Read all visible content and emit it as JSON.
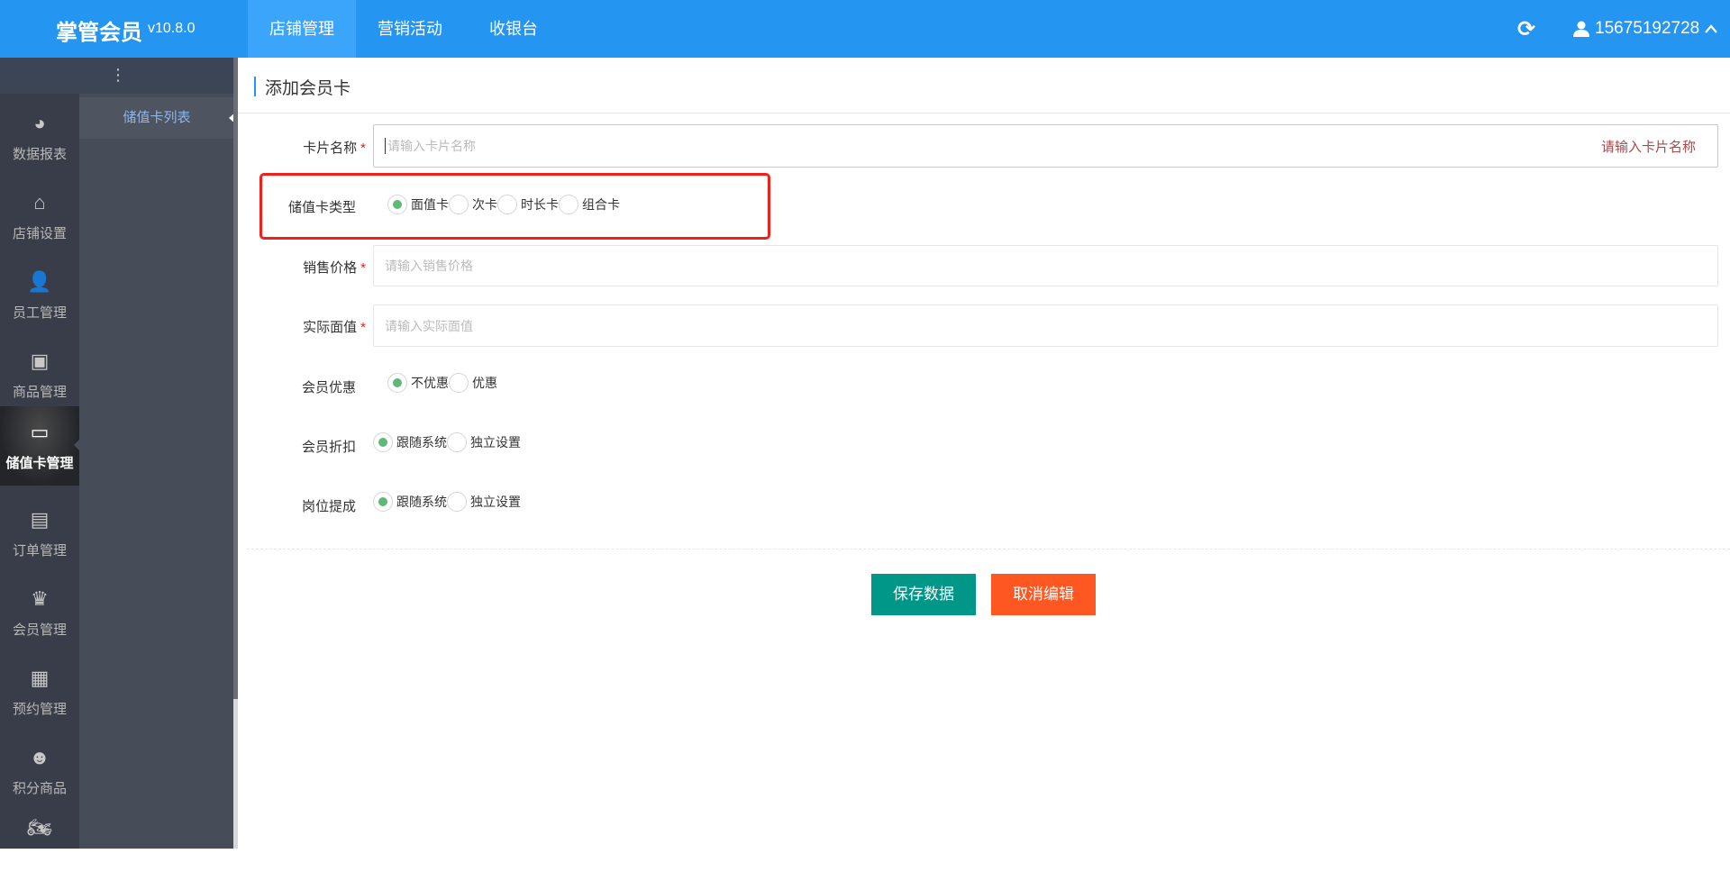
{
  "header": {
    "app_name": "掌管会员",
    "version": "v10.8.0",
    "nav": [
      "店铺管理",
      "营销活动",
      "收银台"
    ],
    "active_nav": "店铺管理",
    "user": "15675192728"
  },
  "sidebar": {
    "items": [
      {
        "label": "数据报表",
        "icon": "pie-chart-icon"
      },
      {
        "label": "店铺设置",
        "icon": "store-settings-icon"
      },
      {
        "label": "员工管理",
        "icon": "employee-icon"
      },
      {
        "label": "商品管理",
        "icon": "bag-icon"
      },
      {
        "label": "储值卡管理",
        "icon": "card-icon"
      },
      {
        "label": "订单管理",
        "icon": "clipboard-icon"
      },
      {
        "label": "会员管理",
        "icon": "crown-icon"
      },
      {
        "label": "预约管理",
        "icon": "calendar-icon"
      },
      {
        "label": "积分商品",
        "icon": "robot-icon"
      },
      {
        "label": "",
        "icon": "motorcycle-icon"
      }
    ],
    "active": "储值卡管理"
  },
  "subnav": {
    "items": [
      "储值卡列表"
    ]
  },
  "page": {
    "title": "添加会员卡"
  },
  "form": {
    "card_name": {
      "label": "卡片名称",
      "placeholder": "请输入卡片名称",
      "error": "请输入卡片名称"
    },
    "card_type": {
      "label": "储值卡类型",
      "options": [
        "面值卡",
        "次卡",
        "时长卡",
        "组合卡"
      ],
      "selected": "面值卡"
    },
    "sale_price": {
      "label": "销售价格",
      "placeholder": "请输入销售价格"
    },
    "face_value": {
      "label": "实际面值",
      "placeholder": "请输入实际面值"
    },
    "member_discount": {
      "label": "会员优惠",
      "options": [
        "不优惠",
        "优惠"
      ],
      "selected": "不优惠"
    },
    "member_rebate": {
      "label": "会员折扣",
      "options": [
        "跟随系统",
        "独立设置"
      ],
      "selected": "跟随系统"
    },
    "commission": {
      "label": "岗位提成",
      "options": [
        "跟随系统",
        "独立设置"
      ],
      "selected": "跟随系统"
    },
    "required_mark": "*"
  },
  "buttons": {
    "save": "保存数据",
    "cancel": "取消编辑"
  },
  "colors": {
    "header": "#2495f0",
    "save": "#009688",
    "cancel": "#ff5722",
    "highlight": "#f0201a"
  }
}
